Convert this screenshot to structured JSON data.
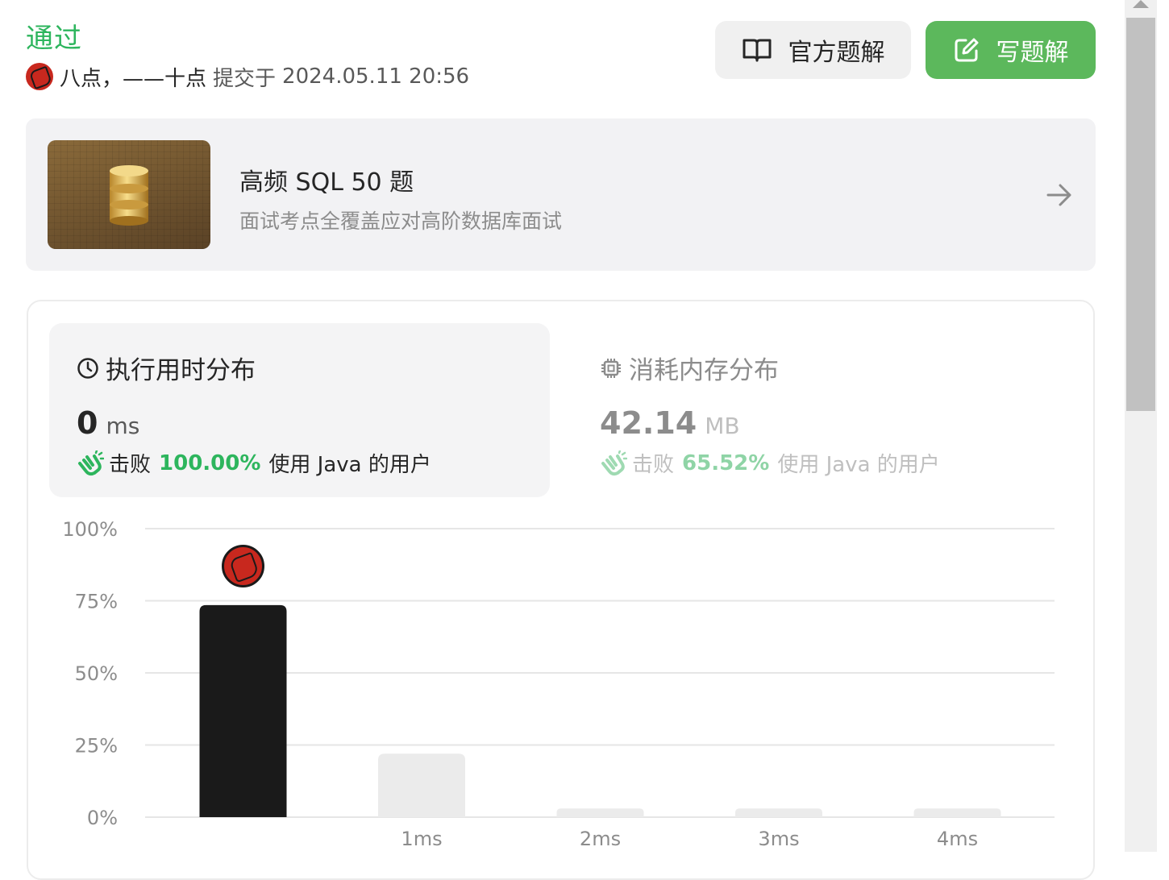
{
  "header": {
    "status": "通过",
    "user_name": "八点，——十点",
    "submitted_label": "提交于",
    "submitted_time": "2024.05.11 20:56",
    "official_solution_label": "官方题解",
    "write_solution_label": "写题解"
  },
  "promo": {
    "title": "高频 SQL 50 题",
    "subtitle": "面试考点全覆盖应对高阶数据库面试"
  },
  "runtime": {
    "title": "执行用时分布",
    "value": "0",
    "unit": "ms",
    "beats_label": "击败",
    "beats_pct": "100.00%",
    "beats_suffix": "使用 Java 的用户"
  },
  "memory": {
    "title": "消耗内存分布",
    "value": "42.14",
    "unit": "MB",
    "beats_label": "击败",
    "beats_pct": "65.52%",
    "beats_suffix": "使用 Java 的用户"
  },
  "colors": {
    "accent_green": "#2db55d",
    "button_green": "#5cb85c",
    "bar_highlight": "#1a1a1a",
    "bar_default": "#ebebeb"
  },
  "icons": [
    "book-icon",
    "edit-icon",
    "database-icon",
    "arrow-right-icon",
    "clock-icon",
    "chip-icon",
    "clap-icon",
    "avatar"
  ],
  "chart_data": {
    "type": "bar",
    "categories": [
      "",
      "1ms",
      "2ms",
      "3ms",
      "4ms"
    ],
    "values": [
      73.5,
      22,
      3,
      3,
      3
    ],
    "highlight_index": 0,
    "y_ticks": [
      "0%",
      "25%",
      "50%",
      "75%",
      "100%"
    ],
    "ylim": [
      0,
      100
    ],
    "grid": true
  }
}
